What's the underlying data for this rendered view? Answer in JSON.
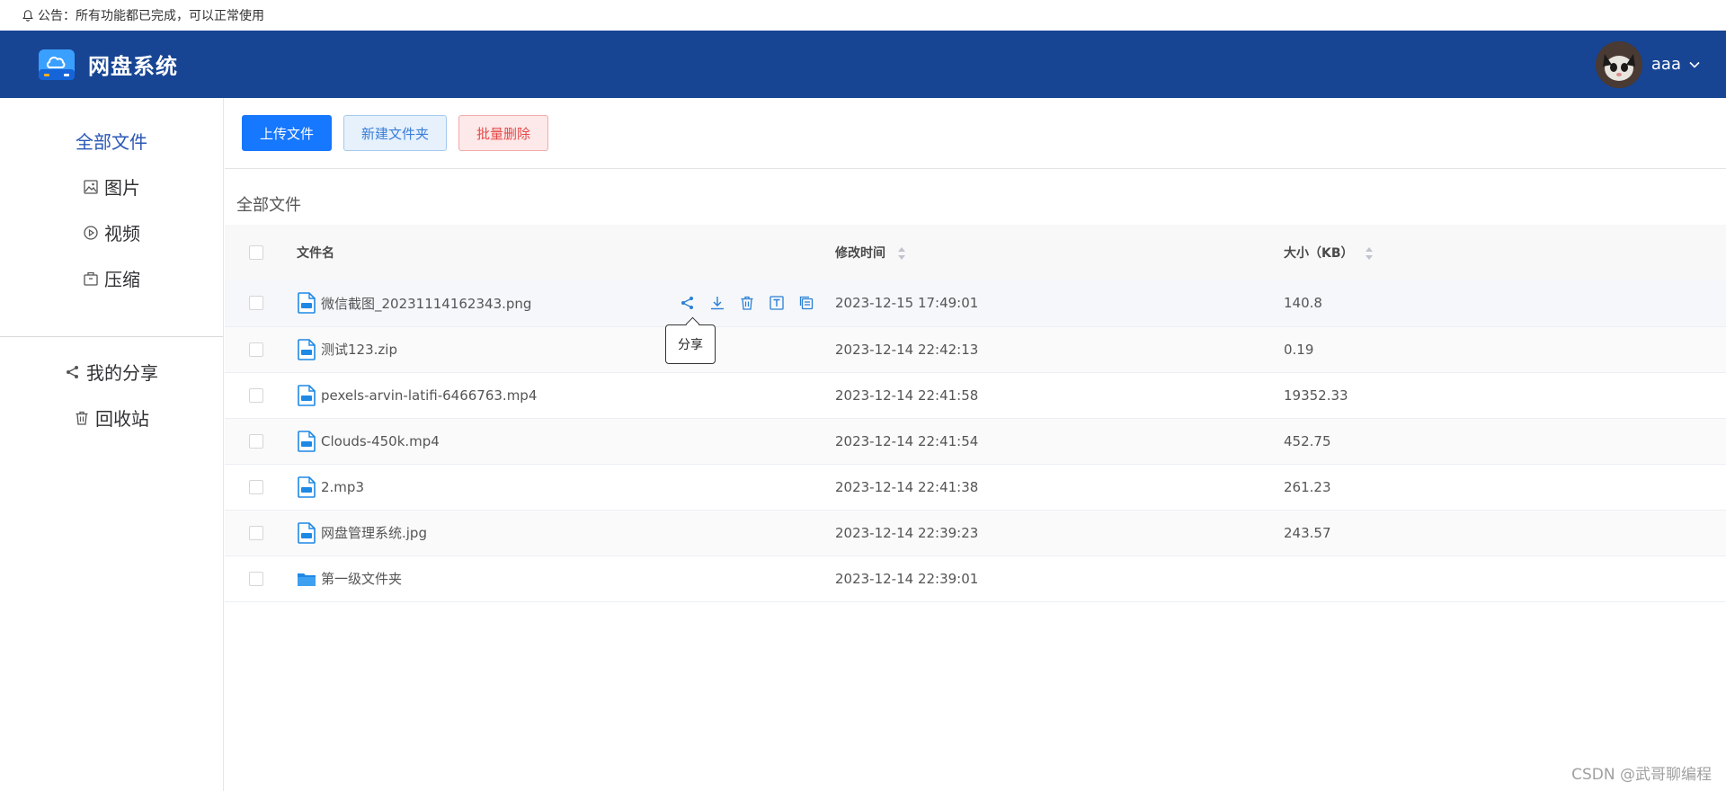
{
  "notice": {
    "text": "公告：所有功能都已完成，可以正常使用"
  },
  "header": {
    "app_name": "网盘系统",
    "username": "aaa"
  },
  "sidebar": {
    "items": [
      {
        "label": "全部文件",
        "icon": "none",
        "active": true
      },
      {
        "label": "图片",
        "icon": "picture-icon"
      },
      {
        "label": "视频",
        "icon": "video-play-icon"
      },
      {
        "label": "压缩",
        "icon": "box-icon"
      }
    ],
    "items2": [
      {
        "label": "我的分享",
        "icon": "share-icon"
      },
      {
        "label": "回收站",
        "icon": "trash-icon"
      }
    ]
  },
  "toolbar": {
    "upload": "上传文件",
    "new_folder": "新建文件夹",
    "batch_delete": "批量删除"
  },
  "breadcrumb": "全部文件",
  "table": {
    "headers": {
      "name": "文件名",
      "time": "修改时间",
      "size": "大小（KB）"
    },
    "rows": [
      {
        "name": "微信截图_20231114162343.png",
        "time": "2023-12-15 17:49:01",
        "size": "140.8",
        "type": "file"
      },
      {
        "name": "测试123.zip",
        "time": "2023-12-14 22:42:13",
        "size": "0.19",
        "type": "file"
      },
      {
        "name": "pexels-arvin-latifi-6466763.mp4",
        "time": "2023-12-14 22:41:58",
        "size": "19352.33",
        "type": "file"
      },
      {
        "name": "Clouds-450k.mp4",
        "time": "2023-12-14 22:41:54",
        "size": "452.75",
        "type": "file"
      },
      {
        "name": "2.mp3",
        "time": "2023-12-14 22:41:38",
        "size": "261.23",
        "type": "file"
      },
      {
        "name": "网盘管理系统.jpg",
        "time": "2023-12-14 22:39:23",
        "size": "243.57",
        "type": "file"
      },
      {
        "name": "第一级文件夹",
        "time": "2023-12-14 22:39:01",
        "size": "",
        "type": "folder"
      }
    ]
  },
  "tooltip": "分享",
  "watermark": "CSDN @武哥聊编程",
  "colors": {
    "header_bg": "#174594",
    "primary": "#1677ff",
    "active_nav": "#2a57b7",
    "danger": "#e54848"
  }
}
